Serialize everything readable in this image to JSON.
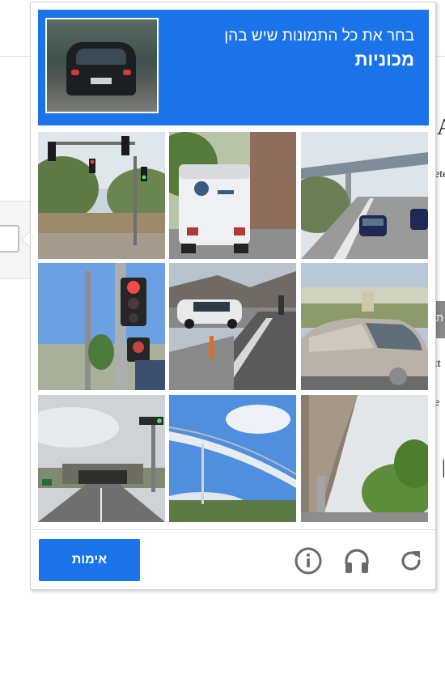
{
  "background": {
    "fragments": [
      "A",
      "ete",
      "tt",
      "e",
      "|",
      "ת"
    ]
  },
  "challenge": {
    "instruction": "בחר את כל התמונות שיש בהן",
    "target": "מכוניות",
    "verify_label": "אימות",
    "tiles": [
      {
        "scene": "traffic-lights-street"
      },
      {
        "scene": "white-bus-rear"
      },
      {
        "scene": "highway-overpass-cars"
      },
      {
        "scene": "traffic-signal-pole"
      },
      {
        "scene": "parked-car-bike-lane"
      },
      {
        "scene": "silver-car-closeup"
      },
      {
        "scene": "road-tunnel-signal"
      },
      {
        "scene": "pedestrian-bridge"
      },
      {
        "scene": "overpass-trees"
      }
    ]
  },
  "icons": {
    "info": "info-icon",
    "audio": "headphones-icon",
    "reload": "reload-icon"
  },
  "colors": {
    "accent": "#1a73e8"
  }
}
